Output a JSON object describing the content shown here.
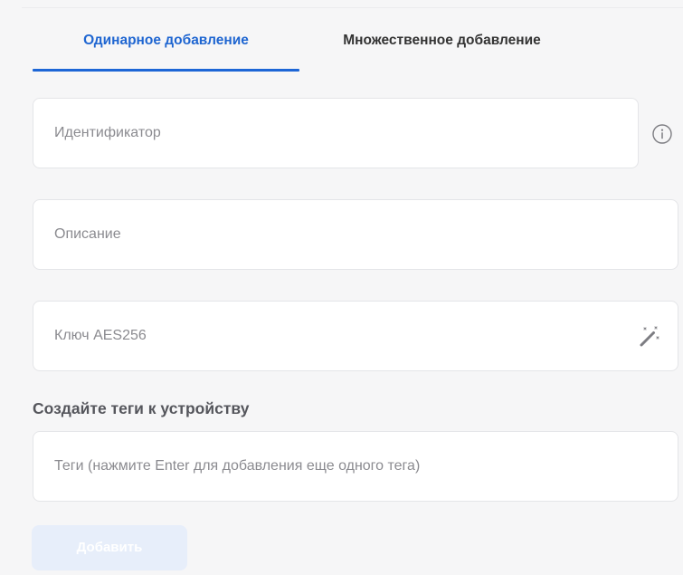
{
  "tabs": {
    "single_label": "Одинарное добавление",
    "multi_label": "Множественное добавление",
    "active": "single"
  },
  "fields": {
    "identifier_placeholder": "Идентификатор",
    "description_placeholder": "Описание",
    "key_placeholder": "Ключ AES256",
    "tags_placeholder": "Теги (нажмите Enter для добавления еще одного тега)"
  },
  "section": {
    "tags_title": "Создайте теги к устройству"
  },
  "actions": {
    "add_label": "Добавить",
    "add_disabled": true
  },
  "icons": {
    "info": "info-icon",
    "generate": "magic-wand-icon"
  },
  "colors": {
    "accent": "#1d66d6",
    "background": "#f6f6f7",
    "field_background": "#ffffff",
    "disabled_button": "#e7eefa"
  }
}
